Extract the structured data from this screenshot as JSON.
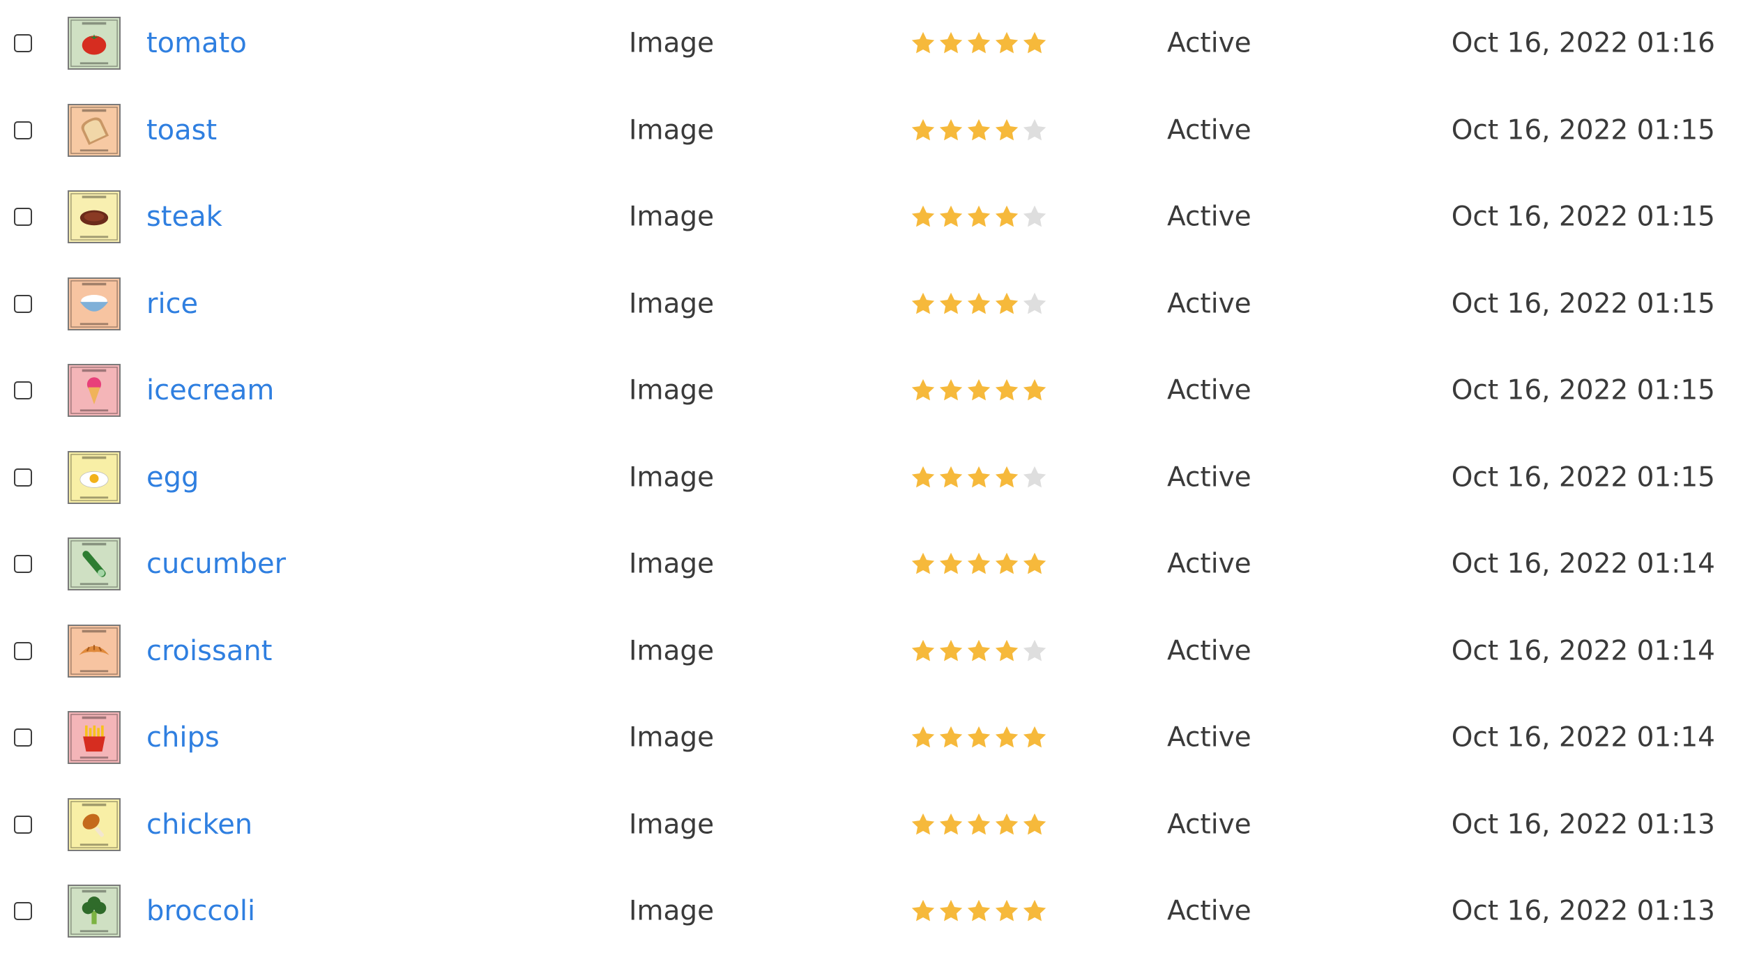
{
  "colors": {
    "link": "#2f7fe0",
    "text": "#3a3a3a",
    "star_filled": "#f6b93b",
    "star_empty": "#dedede"
  },
  "rows": [
    {
      "name": "tomato",
      "type": "Image",
      "rating": 5,
      "status": "Active",
      "date": "Oct 16, 2022 01:16",
      "icon": "tomato-icon",
      "thumb_bg": "#cfe0c3",
      "thumb_accent": "#d62d20"
    },
    {
      "name": "toast",
      "type": "Image",
      "rating": 4,
      "status": "Active",
      "date": "Oct 16, 2022 01:15",
      "icon": "toast-icon",
      "thumb_bg": "#f7c9a3",
      "thumb_accent": "#c99766"
    },
    {
      "name": "steak",
      "type": "Image",
      "rating": 4,
      "status": "Active",
      "date": "Oct 16, 2022 01:15",
      "icon": "steak-icon",
      "thumb_bg": "#f8efb0",
      "thumb_accent": "#6b2a1a"
    },
    {
      "name": "rice",
      "type": "Image",
      "rating": 4,
      "status": "Active",
      "date": "Oct 16, 2022 01:15",
      "icon": "rice-bowl-icon",
      "thumb_bg": "#f7c4a1",
      "thumb_accent": "#7fb0d8"
    },
    {
      "name": "icecream",
      "type": "Image",
      "rating": 5,
      "status": "Active",
      "date": "Oct 16, 2022 01:15",
      "icon": "ice-cream-icon",
      "thumb_bg": "#f4b5b8",
      "thumb_accent": "#e8407a"
    },
    {
      "name": "egg",
      "type": "Image",
      "rating": 4,
      "status": "Active",
      "date": "Oct 16, 2022 01:15",
      "icon": "fried-egg-icon",
      "thumb_bg": "#f8efa6",
      "thumb_accent": "#f2b21a"
    },
    {
      "name": "cucumber",
      "type": "Image",
      "rating": 5,
      "status": "Active",
      "date": "Oct 16, 2022 01:14",
      "icon": "cucumber-icon",
      "thumb_bg": "#cfe0c3",
      "thumb_accent": "#2e7d32"
    },
    {
      "name": "croissant",
      "type": "Image",
      "rating": 4,
      "status": "Active",
      "date": "Oct 16, 2022 01:14",
      "icon": "croissant-icon",
      "thumb_bg": "#f7c4a1",
      "thumb_accent": "#e08a3c"
    },
    {
      "name": "chips",
      "type": "Image",
      "rating": 5,
      "status": "Active",
      "date": "Oct 16, 2022 01:14",
      "icon": "fries-icon",
      "thumb_bg": "#f4b5b8",
      "thumb_accent": "#f7c21a"
    },
    {
      "name": "chicken",
      "type": "Image",
      "rating": 5,
      "status": "Active",
      "date": "Oct 16, 2022 01:13",
      "icon": "chicken-leg-icon",
      "thumb_bg": "#f8efa6",
      "thumb_accent": "#c46a1c"
    },
    {
      "name": "broccoli",
      "type": "Image",
      "rating": 5,
      "status": "Active",
      "date": "Oct 16, 2022 01:13",
      "icon": "broccoli-icon",
      "thumb_bg": "#cfe0c3",
      "thumb_accent": "#2f6b2a"
    }
  ]
}
